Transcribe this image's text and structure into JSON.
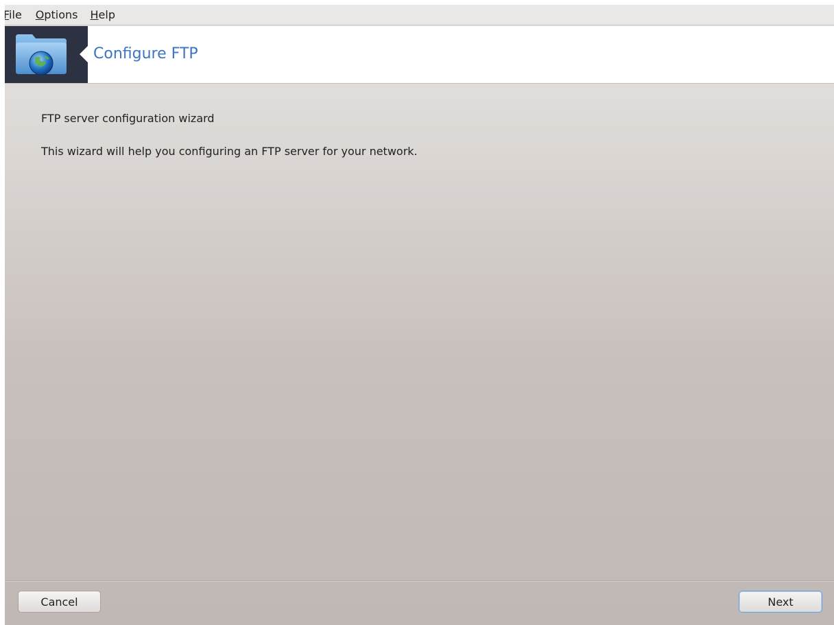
{
  "menubar": {
    "items": [
      {
        "accel": "F",
        "rest": "ile"
      },
      {
        "accel": "O",
        "rest": "ptions"
      },
      {
        "accel": "H",
        "rest": "elp"
      }
    ]
  },
  "header": {
    "icon": "folder-globe-icon",
    "title": "Configure FTP"
  },
  "content": {
    "heading": "FTP server configuration wizard",
    "description": "This wizard will help you configuring an FTP server for your network."
  },
  "footer": {
    "cancel_label": "Cancel",
    "next_label": "Next"
  },
  "colors": {
    "title_accent": "#3d74c4",
    "icon_background": "#2c3242",
    "default_button_border": "#6b9fd6"
  }
}
